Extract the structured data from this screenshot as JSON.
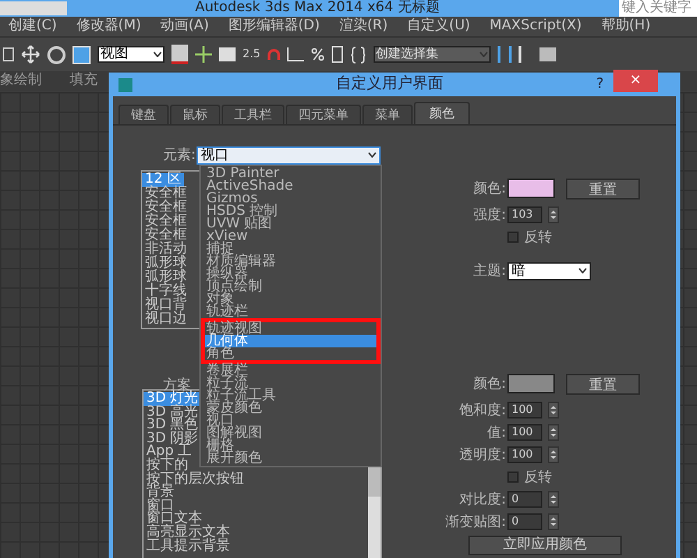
{
  "app": {
    "title": "Autodesk 3ds Max  2014 x64      无标题",
    "search": {
      "placeholder": "键入关键字"
    },
    "menu": [
      "创建(C)",
      "修改器(M)",
      "动画(A)",
      "图形编辑器(D)",
      "渲染(R)",
      "自定义(U)",
      "MAXScript(X)",
      "帮助(H)"
    ],
    "toolbar": {
      "view_select": "视图",
      "snap_label": "2.5",
      "selection_set": "创建选择集"
    },
    "ribbon": [
      "象绘制",
      "填充"
    ]
  },
  "dialog": {
    "title": "自定义用户界面",
    "help": "?",
    "close": "×",
    "tabs": [
      {
        "label": "键盘",
        "selected": false
      },
      {
        "label": "鼠标",
        "selected": false
      },
      {
        "label": "工具栏",
        "selected": false
      },
      {
        "label": "四元菜单",
        "selected": false
      },
      {
        "label": "菜单",
        "selected": false
      },
      {
        "label": "颜色",
        "selected": true
      }
    ],
    "element": {
      "label": "元素:",
      "value": "视口"
    },
    "elements_list": [
      {
        "label": "12 区",
        "selected": true
      },
      {
        "label": "安全框",
        "selected": false
      },
      {
        "label": "安全框",
        "selected": false
      },
      {
        "label": "安全框",
        "selected": false
      },
      {
        "label": "安全框",
        "selected": false
      },
      {
        "label": "非活动",
        "selected": false
      },
      {
        "label": "弧形球",
        "selected": false
      },
      {
        "label": "弧形球",
        "selected": false
      },
      {
        "label": "十字线",
        "selected": false
      },
      {
        "label": "视口背",
        "selected": false
      },
      {
        "label": "视口边",
        "selected": false
      }
    ],
    "dropdown": [
      {
        "label": "3D Painter",
        "selected": false,
        "framed": false
      },
      {
        "label": "ActiveShade",
        "selected": false,
        "framed": false
      },
      {
        "label": "Gizmos",
        "selected": false,
        "framed": false
      },
      {
        "label": "HSDS 控制",
        "selected": false,
        "framed": false
      },
      {
        "label": "UVW 贴图",
        "selected": false,
        "framed": false
      },
      {
        "label": "xView",
        "selected": false,
        "framed": false
      },
      {
        "label": "捕捉",
        "selected": false,
        "framed": false
      },
      {
        "label": "材质编辑器",
        "selected": false,
        "framed": false
      },
      {
        "label": "操纵器",
        "selected": false,
        "framed": false
      },
      {
        "label": "顶点绘制",
        "selected": false,
        "framed": false
      },
      {
        "label": "对象",
        "selected": false,
        "framed": false
      },
      {
        "label": "轨迹栏",
        "selected": false,
        "framed": false
      },
      {
        "label": "轨迹视图",
        "selected": false,
        "framed": true
      },
      {
        "label": "几何体",
        "selected": true,
        "framed": true
      },
      {
        "label": "角色",
        "selected": false,
        "framed": true
      },
      {
        "label": "卷展栏",
        "selected": false,
        "framed": false
      },
      {
        "label": "粒子流",
        "selected": false,
        "framed": false
      },
      {
        "label": "粒子流工具",
        "selected": false,
        "framed": false
      },
      {
        "label": "蒙皮颜色",
        "selected": false,
        "framed": false
      },
      {
        "label": "视口",
        "selected": false,
        "framed": false
      },
      {
        "label": "图解视图",
        "selected": false,
        "framed": false
      },
      {
        "label": "栅格",
        "selected": false,
        "framed": false
      },
      {
        "label": "展开颜色",
        "selected": false,
        "framed": false
      }
    ],
    "scheme_label": "方案",
    "scheme_list": [
      {
        "label": "3D 灯光",
        "selected": true
      },
      {
        "label": "3D 高光",
        "selected": false
      },
      {
        "label": "3D 黑色",
        "selected": false
      },
      {
        "label": "3D 阴影",
        "selected": false
      },
      {
        "label": "App 工",
        "selected": false
      },
      {
        "label": "按下的",
        "selected": false
      },
      {
        "label": "按下的层次按钮",
        "selected": false
      },
      {
        "label": "背景",
        "selected": false
      },
      {
        "label": "窗口",
        "selected": false
      },
      {
        "label": "窗口文本",
        "selected": false
      },
      {
        "label": "高亮显示文本",
        "selected": false
      },
      {
        "label": "工具提示背景",
        "selected": false
      }
    ],
    "element_color": {
      "label": "颜色:",
      "color": "#e8bde8",
      "reset": "重置",
      "fields": [
        {
          "kind": "spinner",
          "label": "强度:",
          "value": "103"
        },
        {
          "kind": "checkbox",
          "label": "反转",
          "checked": false
        },
        {
          "kind": "gap"
        },
        {
          "kind": "select",
          "label": "主题:",
          "value": "暗"
        }
      ]
    },
    "scheme_color": {
      "label": "颜色:",
      "color": "#888888",
      "reset": "重置",
      "fields": [
        {
          "kind": "spinner",
          "label": "饱和度:",
          "value": "100"
        },
        {
          "kind": "spinner",
          "label": "值:",
          "value": "100"
        },
        {
          "kind": "spinner",
          "label": "透明度:",
          "value": "100"
        },
        {
          "kind": "checkbox",
          "label": "反转",
          "checked": false
        },
        {
          "kind": "spinner",
          "label": "对比度:",
          "value": "0"
        },
        {
          "kind": "spinner",
          "label": "渐变贴图:",
          "value": "0"
        }
      ]
    },
    "apply": "立即应用颜色"
  }
}
